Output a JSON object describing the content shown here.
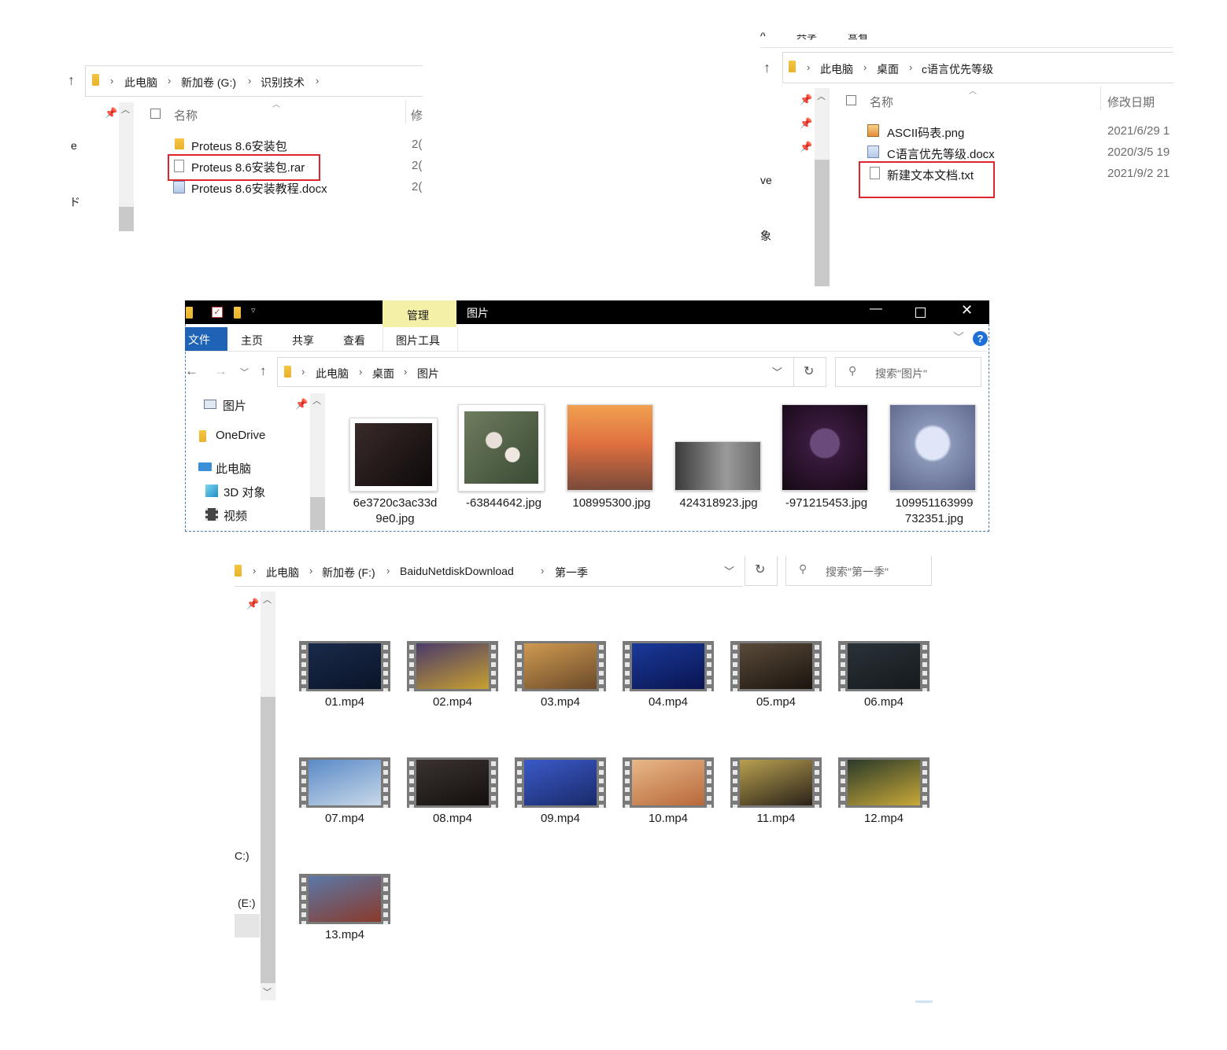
{
  "win1": {
    "breadcrumb": [
      "此电脑",
      "新加卷 (G:)",
      "识别技术"
    ],
    "col_name": "名称",
    "col_modified_partial": "修",
    "side_partial": [
      "e",
      "ド"
    ],
    "files": [
      {
        "name": "Proteus 8.6安装包",
        "date_partial": "2("
      },
      {
        "name": "Proteus 8.6安装包.rar",
        "date_partial": "2("
      },
      {
        "name": "Proteus 8.6安装教程.docx",
        "date_partial": "2("
      }
    ]
  },
  "win3": {
    "menu_partial": [
      "λ",
      "共享",
      "查看"
    ],
    "breadcrumb": [
      "此电脑",
      "桌面",
      "c语言优先等级"
    ],
    "col_name": "名称",
    "col_modified": "修改日期",
    "side_partial": [
      "ve",
      "象"
    ],
    "files": [
      {
        "name": "ASCII码表.png",
        "date": "2021/6/29 1"
      },
      {
        "name": "C语言优先等级.docx",
        "date": "2020/3/5 19"
      },
      {
        "name": "新建文本文档.txt",
        "date": "2021/9/2 21"
      }
    ]
  },
  "win2": {
    "context_tab": "管理",
    "title": "图片",
    "ribbon_tabs": [
      "文件",
      "主页",
      "共享",
      "查看",
      "图片工具"
    ],
    "breadcrumb": [
      "此电脑",
      "桌面",
      "图片"
    ],
    "search_placeholder": "搜索\"图片\"",
    "nav": [
      {
        "label": "图片"
      },
      {
        "label": "OneDrive"
      },
      {
        "label": "此电脑"
      },
      {
        "label": "3D 对象"
      },
      {
        "label": "视频"
      }
    ],
    "thumbs": [
      {
        "line1": "6e3720c3ac33d",
        "line2": "9e0.jpg",
        "colors": [
          "#3a2a2a",
          "#0e0a0a"
        ]
      },
      {
        "line1": "-63844642.jpg",
        "line2": "",
        "colors": [
          "#6e7c5e",
          "#3a4a34"
        ]
      },
      {
        "line1": "108995300.jpg",
        "line2": "",
        "colors": [
          "#f0a050",
          "#7a4a3a"
        ]
      },
      {
        "line1": "424318923.jpg",
        "line2": "",
        "colors": [
          "#9a9a9a",
          "#3a3a3a"
        ]
      },
      {
        "line1": "-971215453.jpg",
        "line2": "",
        "colors": [
          "#3a1a3e",
          "#140814"
        ]
      },
      {
        "line1": "109951163999",
        "line2": "732351.jpg",
        "colors": [
          "#8a96b8",
          "#5a6488"
        ]
      }
    ]
  },
  "win4": {
    "breadcrumb": [
      "此电脑",
      "新加卷 (F:)",
      "BaiduNetdiskDownload",
      "第一季"
    ],
    "search_placeholder": "搜索\"第一季\"",
    "side_partial": [
      "C:)",
      "(E:)"
    ],
    "videos": [
      {
        "name": "01.mp4",
        "colors": [
          "#1a2a4a",
          "#0a1428"
        ]
      },
      {
        "name": "02.mp4",
        "colors": [
          "#4a3a6a",
          "#c8a030"
        ]
      },
      {
        "name": "03.mp4",
        "colors": [
          "#d09a50",
          "#6a4a2a"
        ]
      },
      {
        "name": "04.mp4",
        "colors": [
          "#1a3a9a",
          "#0a1450"
        ]
      },
      {
        "name": "05.mp4",
        "colors": [
          "#5a4a3a",
          "#1a140e"
        ]
      },
      {
        "name": "06.mp4",
        "colors": [
          "#2a3238",
          "#141a1e"
        ]
      },
      {
        "name": "07.mp4",
        "colors": [
          "#5a8ac8",
          "#c8d8e8"
        ]
      },
      {
        "name": "08.mp4",
        "colors": [
          "#3a3230",
          "#14100e"
        ]
      },
      {
        "name": "09.mp4",
        "colors": [
          "#3a5ac8",
          "#1a2a6a"
        ]
      },
      {
        "name": "10.mp4",
        "colors": [
          "#e8b888",
          "#b8683a"
        ]
      },
      {
        "name": "11.mp4",
        "colors": [
          "#b8a050",
          "#2a2218"
        ]
      },
      {
        "name": "12.mp4",
        "colors": [
          "#2a3a2a",
          "#c8a838"
        ]
      },
      {
        "name": "13.mp4",
        "colors": [
          "#5a78a8",
          "#8a3a2a"
        ]
      }
    ]
  }
}
